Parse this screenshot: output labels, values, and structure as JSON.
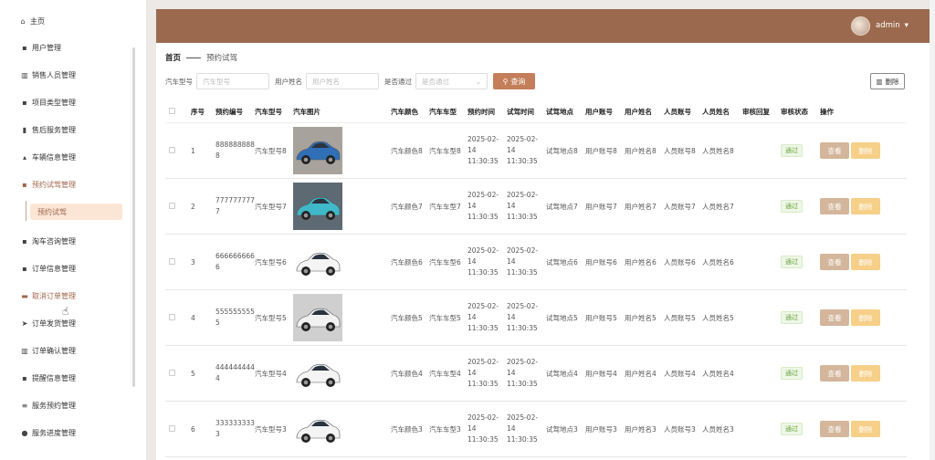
{
  "sidebar": {
    "items": [
      {
        "label": "主页",
        "icon": "home-icon"
      },
      {
        "label": "用户管理",
        "icon": "grid-icon"
      },
      {
        "label": "销售人员管理",
        "icon": "building-icon"
      },
      {
        "label": "项目类型管理",
        "icon": "grid-icon"
      },
      {
        "label": "售后服务管理",
        "icon": "bar-chart-icon"
      },
      {
        "label": "车辆信息管理",
        "icon": "chart-icon"
      },
      {
        "label": "预约试驾管理",
        "icon": "grid-icon"
      },
      {
        "label": "淘车咨询管理",
        "icon": "grid-icon"
      },
      {
        "label": "订单信息管理",
        "icon": "grid-icon"
      },
      {
        "label": "取消订单管理",
        "icon": "card-icon"
      },
      {
        "label": "订单发货管理",
        "icon": "send-icon"
      },
      {
        "label": "订单确认管理",
        "icon": "building-icon"
      },
      {
        "label": "提醒信息管理",
        "icon": "grid-icon"
      },
      {
        "label": "服务预约管理",
        "icon": "list-icon"
      },
      {
        "label": "服务进度管理",
        "icon": "user-icon"
      }
    ],
    "active_sub": "预约试驾"
  },
  "header": {
    "user": "admin"
  },
  "breadcrumb": {
    "home": "首页",
    "current": "预约试驾"
  },
  "filters": {
    "model_label": "汽车型号",
    "model_placeholder": "汽车型号",
    "name_label": "用户姓名",
    "name_placeholder": "用户姓名",
    "pass_label": "是否通过",
    "pass_placeholder": "是否通过",
    "search_label": "查询"
  },
  "toolbar": {
    "delete_label": "删除"
  },
  "table": {
    "headers": [
      "序号",
      "预约编号",
      "汽车型号",
      "汽车图片",
      "汽车颜色",
      "汽车车型",
      "预约时间",
      "试驾时间",
      "试驾地点",
      "用户账号",
      "用户姓名",
      "人员账号",
      "人员姓名",
      "审核回复",
      "审核状态",
      "操作"
    ],
    "view_label": "查看",
    "del_label": "删除",
    "rows": [
      {
        "idx": "1",
        "no": "8888888888",
        "model": "汽车型号8",
        "color": "汽车颜色8",
        "type": "汽车车型8",
        "btime": "2025-02-14 11:30:35",
        "dtime": "2025-02-14 11:30:35",
        "place": "试驾地点8",
        "acc": "用户账号8",
        "name": "用户姓名8",
        "pacc": "人员账号8",
        "pname": "人员姓名8",
        "reply": "",
        "status": "通过",
        "img": "blue"
      },
      {
        "idx": "2",
        "no": "7777777777",
        "model": "汽车型号7",
        "color": "汽车颜色7",
        "type": "汽车车型7",
        "btime": "2025-02-14 11:30:35",
        "dtime": "2025-02-14 11:30:35",
        "place": "试驾地点7",
        "acc": "用户账号7",
        "name": "用户姓名7",
        "pacc": "人员账号7",
        "pname": "人员姓名7",
        "reply": "",
        "status": "通过",
        "img": "cyan"
      },
      {
        "idx": "3",
        "no": "6666666666",
        "model": "汽车型号6",
        "color": "汽车颜色6",
        "type": "汽车车型6",
        "btime": "2025-02-14 11:30:35",
        "dtime": "2025-02-14 11:30:35",
        "place": "试驾地点6",
        "acc": "用户账号6",
        "name": "用户姓名6",
        "pacc": "人员账号6",
        "pname": "人员姓名6",
        "reply": "",
        "status": "通过",
        "img": "white"
      },
      {
        "idx": "4",
        "no": "5555555555",
        "model": "汽车型号5",
        "color": "汽车颜色5",
        "type": "汽车车型5",
        "btime": "2025-02-14 11:30:35",
        "dtime": "2025-02-14 11:30:35",
        "place": "试驾地点5",
        "acc": "用户账号5",
        "name": "用户姓名5",
        "pacc": "人员账号5",
        "pname": "人员姓名5",
        "reply": "",
        "status": "通过",
        "img": "suv"
      },
      {
        "idx": "5",
        "no": "4444444444",
        "model": "汽车型号4",
        "color": "汽车颜色4",
        "type": "汽车车型4",
        "btime": "2025-02-14 11:30:35",
        "dtime": "2025-02-14 11:30:35",
        "place": "试驾地点4",
        "acc": "用户账号4",
        "name": "用户姓名4",
        "pacc": "人员账号4",
        "pname": "人员姓名4",
        "reply": "",
        "status": "通过",
        "img": "white"
      },
      {
        "idx": "6",
        "no": "3333333333",
        "model": "汽车型号3",
        "color": "汽车颜色3",
        "type": "汽车车型3",
        "btime": "2025-02-14 11:30:35",
        "dtime": "2025-02-14 11:30:35",
        "place": "试驾地点3",
        "acc": "用户账号3",
        "name": "用户姓名3",
        "pacc": "人员账号3",
        "pname": "人员姓名3",
        "reply": "",
        "status": "通过",
        "img": "white"
      }
    ]
  },
  "colors": {
    "header": "#9b6a4e",
    "accent": "#c47e5a",
    "view": "#d3b69b",
    "delete": "#f6cf88",
    "pass": "#67a33a"
  }
}
